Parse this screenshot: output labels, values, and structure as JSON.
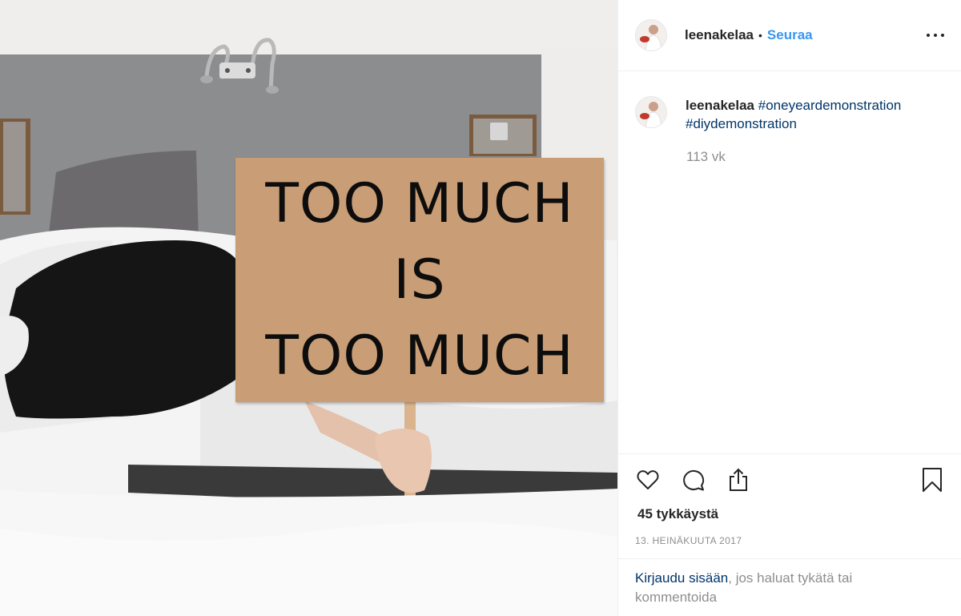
{
  "post": {
    "image_alt_sign": [
      "TOO MUCH",
      "IS",
      "TOO MUCH"
    ]
  },
  "header": {
    "username": "leenakelaa",
    "separator": "•",
    "follow_label": "Seuraa",
    "more_icon": "more-horizontal-icon"
  },
  "caption": {
    "username": "leenakelaa",
    "hashtags": [
      "#oneyeardemonstration",
      "#diydemonstration"
    ],
    "time_ago": "113 vk"
  },
  "actions": {
    "like_icon": "heart-icon",
    "comment_icon": "comment-bubble-icon",
    "share_icon": "share-icon",
    "save_icon": "bookmark-icon"
  },
  "likes_text": "45 tykkäystä",
  "date_text": "13. HEINÄKUUTA 2017",
  "login_prompt": {
    "link": "Kirjaudu sisään",
    "rest": ", jos haluat tykätä tai kommentoida"
  },
  "colors": {
    "accent_blue": "#3897f0",
    "link_dark_blue": "#003569",
    "muted_gray": "#8e8e8e",
    "sign_cardboard": "#c99d75"
  }
}
